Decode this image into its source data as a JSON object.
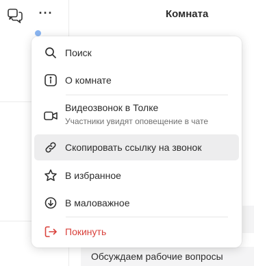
{
  "header": {
    "room_title": "Комната"
  },
  "menu": {
    "items": [
      {
        "label": "Поиск",
        "icon": "search-icon"
      },
      {
        "label": "О комнате",
        "icon": "info-icon"
      },
      {
        "label": "Видеозвонок в Толке",
        "sublabel": "Участники увидят оповещение в чате",
        "icon": "video-camera-icon"
      },
      {
        "label": "Скопировать ссылку на звонок",
        "icon": "link-icon",
        "highlighted": true
      },
      {
        "label": "В избранное",
        "icon": "star-icon"
      },
      {
        "label": "В маловажное",
        "icon": "arrow-down-circle-icon"
      },
      {
        "label": "Покинуть",
        "icon": "logout-icon",
        "danger": true
      }
    ]
  },
  "background": {
    "message_preview": "Обсуждаем рабочие вопросы"
  },
  "colors": {
    "danger": "#d9413b",
    "highlight": "#ededee",
    "accent_dot": "#8bb6f2"
  }
}
